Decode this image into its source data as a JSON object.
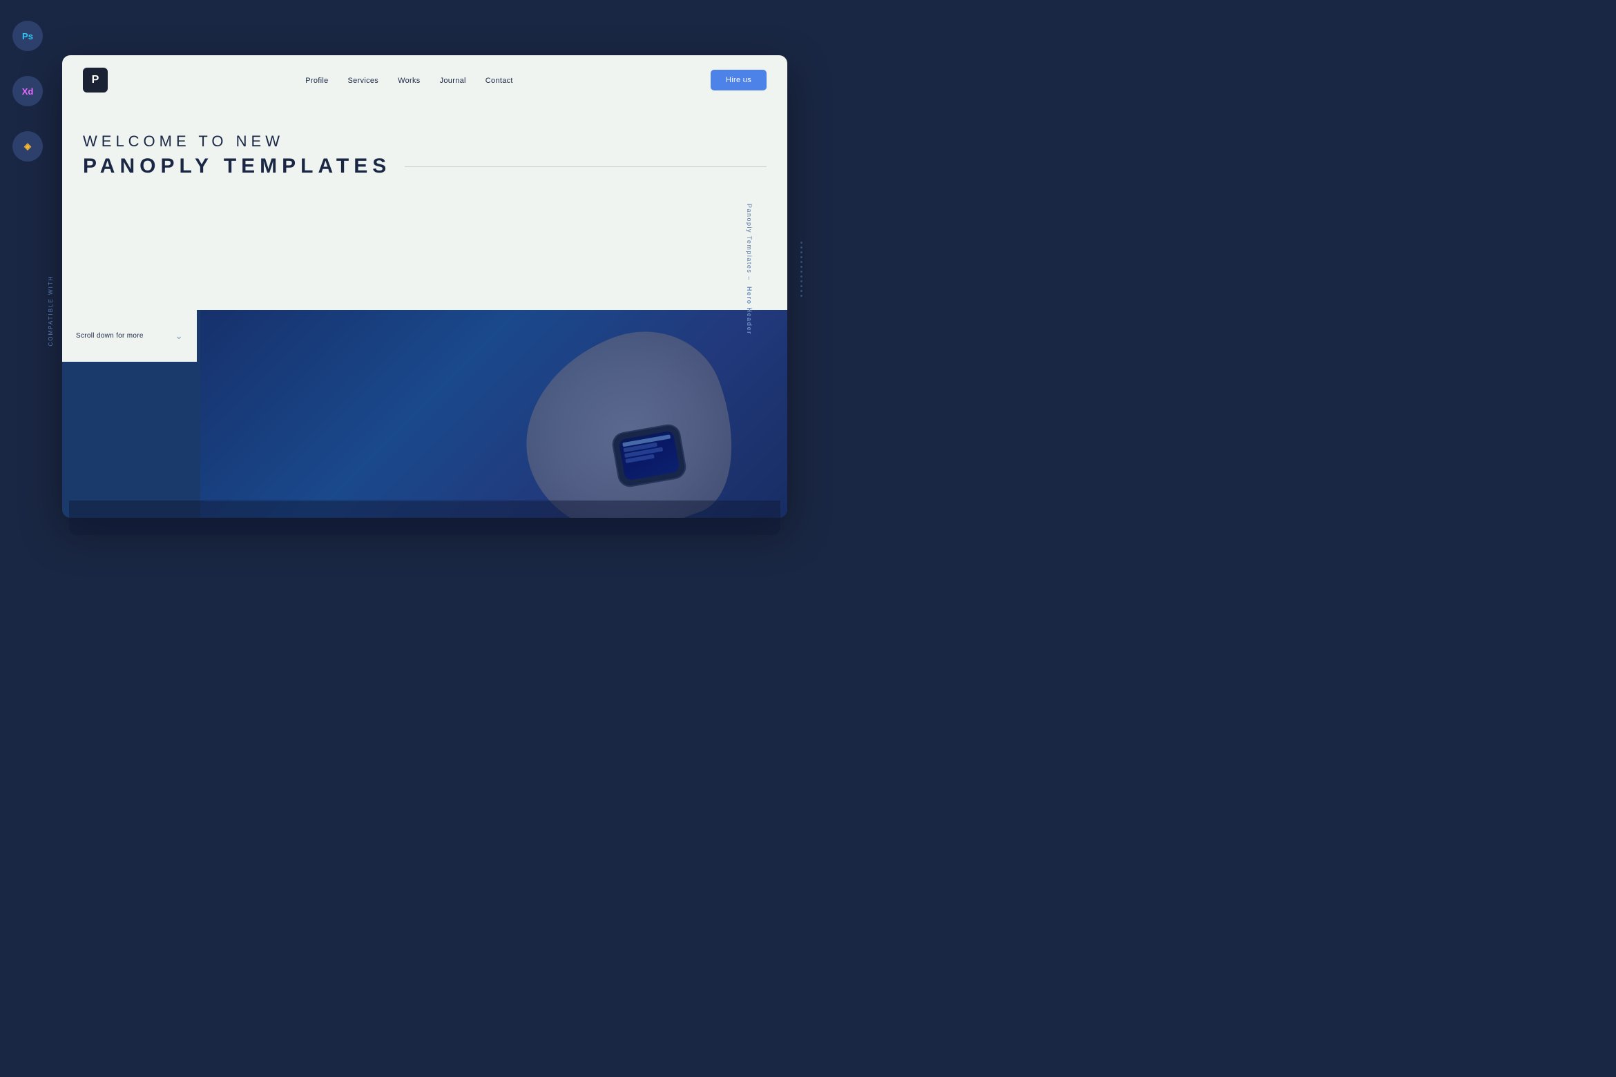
{
  "sidebar": {
    "compatible_label": "COMPATIBLE WITH",
    "icons": [
      {
        "id": "ps",
        "label": "Ps",
        "color": "#31c5f4"
      },
      {
        "id": "xd",
        "label": "Xd",
        "color": "#e86aff"
      },
      {
        "id": "sk",
        "label": "◈",
        "color": "#f7b731"
      }
    ]
  },
  "right_label": {
    "prefix": "Panoply Templates –",
    "suffix": "Hero Header"
  },
  "navbar": {
    "logo": "P",
    "links": [
      "Profile",
      "Services",
      "Works",
      "Journal",
      "Contact"
    ],
    "hire_button": "Hire us"
  },
  "hero": {
    "subtitle": "WELCOME TO NEW",
    "title": "PANOPLY TEMPLATES"
  },
  "scroll": {
    "text": "Scroll down for more",
    "icon": "⌄"
  },
  "dots": [
    1,
    2,
    3,
    4,
    5,
    6,
    7,
    8,
    9,
    10,
    11,
    12
  ]
}
